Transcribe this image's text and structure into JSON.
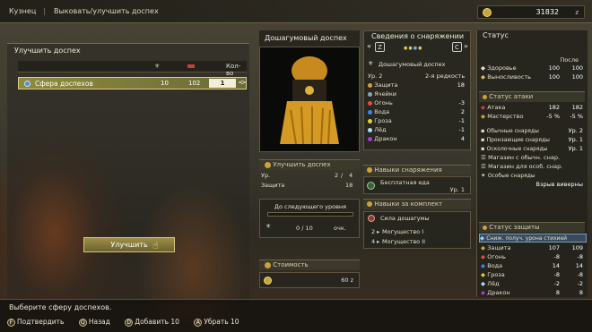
{
  "nav": {
    "crumb1": "Кузнец",
    "crumb2": "Выковать/улучшить доспех"
  },
  "money": {
    "amount": "31832",
    "unit": "z"
  },
  "left": {
    "title": "Улучшить доспех",
    "col3": "Кол-во",
    "row": {
      "name": "Сфера доспехов",
      "have": "10",
      "owned": "102",
      "qty": "1"
    },
    "button": "Улучшить"
  },
  "armor": {
    "name": "Дошагумовый доспех",
    "up_title": "Улучшить доспех",
    "level_label": "Ур.",
    "level_from": "2",
    "level_sep": "/",
    "level_to": "4",
    "defense_label": "Защита",
    "defense_val": "18",
    "next_label": "До следующего уровня",
    "progress": "0 / 10",
    "progress_unit": "очк.",
    "cost_label": "Стоимость",
    "cost_val": "60 z"
  },
  "info": {
    "title": "Сведения о снаряжении",
    "btn_l": "Z",
    "btn_r": "C",
    "name": "Дошагумовый доспех",
    "lvl": "Ур. 2",
    "rarity": "2-я редкость",
    "rows": [
      {
        "k": "Защита",
        "v": "18"
      },
      {
        "k": "Ячейки",
        "v": ""
      },
      {
        "k": "Огонь",
        "v": "-3"
      },
      {
        "k": "Вода",
        "v": "2"
      },
      {
        "k": "Гроза",
        "v": "-1"
      },
      {
        "k": "Лёд",
        "v": "-1"
      },
      {
        "k": "Дракон",
        "v": "4"
      }
    ],
    "skills_title": "Навыки снаряжения",
    "skill": "Бесплатная еда",
    "skill_lv": "Ур. 1",
    "set_title": "Навыки за комплект",
    "set_name": "Сила дошагумы",
    "set1_n": "2",
    "set1": "Могущество I",
    "set2_n": "4",
    "set2": "Могущество II"
  },
  "status": {
    "title": "Статус",
    "after": "После",
    "health": "Здоровье",
    "health_a": "100",
    "health_b": "100",
    "stam": "Выносливость",
    "stam_a": "100",
    "stam_b": "100",
    "atk_title": "Статус атаки",
    "atk": "Атака",
    "atk_a": "182",
    "atk_b": "182",
    "mast": "Мастерство",
    "mast_a": "-5 %",
    "mast_b": "-5 %",
    "ammo": [
      {
        "k": "Обычные снаряды",
        "v": "Ур. 2"
      },
      {
        "k": "Пронзающие снаряды",
        "v": "Ур. 1"
      },
      {
        "k": "Осколочные снаряды",
        "v": "Ур. 1"
      }
    ],
    "mag1": "Магазин с обычн. снар.",
    "mag2": "Магазин для особ. снар.",
    "special": "Особые снаряды",
    "special_v": "Взрыв виверны",
    "def_title": "Статус защиты",
    "reduce": "Сниж. получ. урона стихией",
    "def": [
      {
        "k": "Защита",
        "a": "107",
        "b": "109"
      },
      {
        "k": "Огонь",
        "a": "-8",
        "b": "-8"
      },
      {
        "k": "Вода",
        "a": "14",
        "b": "14"
      },
      {
        "k": "Гроза",
        "a": "-8",
        "b": "-8"
      },
      {
        "k": "Лёд",
        "a": "-2",
        "b": "-2"
      },
      {
        "k": "Дракон",
        "a": "8",
        "b": "8"
      }
    ]
  },
  "footer": {
    "msg": "Выберите сферу доспехов.",
    "k1": "F",
    "a1": "Подтвердить",
    "k2": "Q",
    "a2": "Назад",
    "k3": "D",
    "a3": "Добавить 10",
    "k4": "A",
    "a4": "Убрать 10"
  },
  "colors": {
    "green": "#7dd36a",
    "gold": "#c9a43a"
  }
}
